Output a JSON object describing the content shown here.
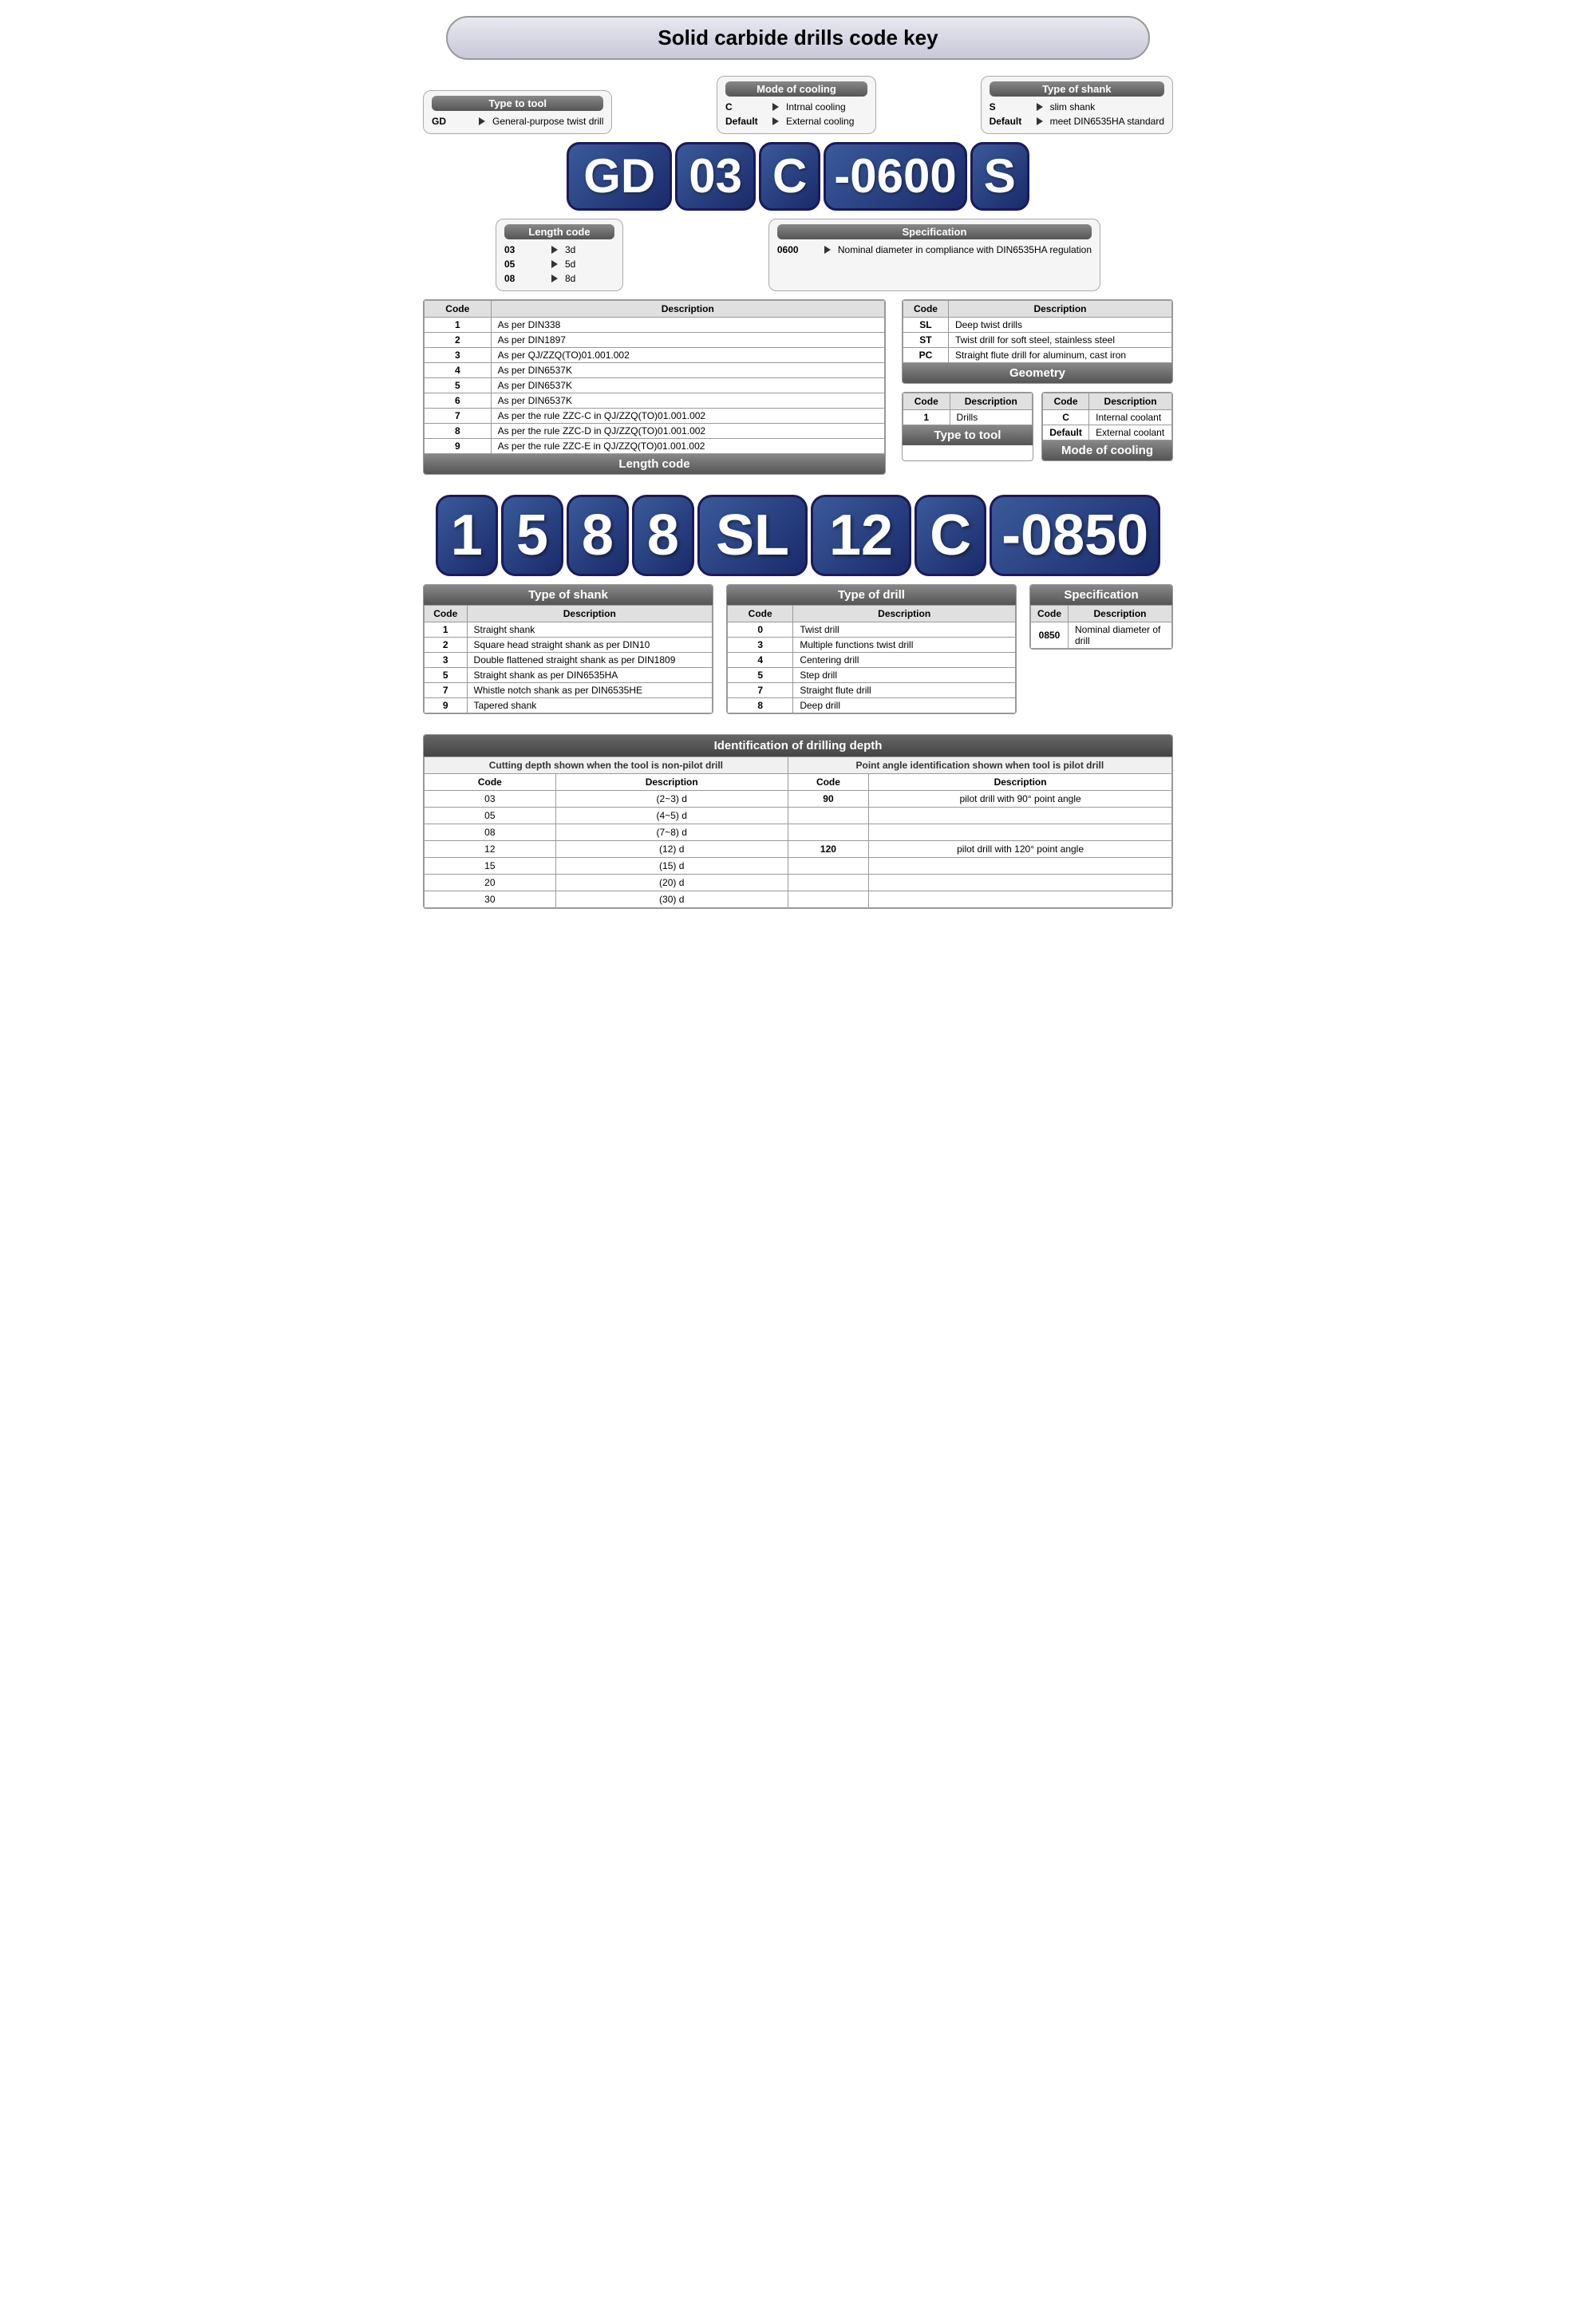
{
  "title": "Solid carbide drills code key",
  "section1": {
    "code_blocks": [
      "GD",
      "03",
      "C",
      "-0600",
      "S"
    ],
    "panels": {
      "type_to_tool": {
        "label": "Type to tool",
        "rows": [
          {
            "code": "GD",
            "desc": "General-purpose twist drill"
          }
        ]
      },
      "mode_of_cooling": {
        "label": "Mode of cooling",
        "rows": [
          {
            "code": "C",
            "desc": "Intrnal cooling"
          },
          {
            "code": "Default",
            "desc": "External cooling"
          }
        ]
      },
      "type_of_shank": {
        "label": "Type of shank",
        "rows": [
          {
            "code": "S",
            "desc": "slim shank"
          },
          {
            "code": "Default",
            "desc": "meet DIN6535HA standard"
          }
        ]
      },
      "length_code": {
        "label": "Length code",
        "rows": [
          {
            "code": "03",
            "desc": "3d"
          },
          {
            "code": "05",
            "desc": "5d"
          },
          {
            "code": "08",
            "desc": "8d"
          }
        ]
      },
      "specification": {
        "label": "Specification",
        "rows": [
          {
            "code": "0600",
            "desc": "Nominal diameter in compliance with DIN6535HA regulation"
          }
        ]
      }
    }
  },
  "section1_tables": {
    "main_table": {
      "headers": [
        "Code",
        "Description"
      ],
      "rows": [
        [
          "1",
          "As per DIN338"
        ],
        [
          "2",
          "As per DIN1897"
        ],
        [
          "3",
          "As per QJ/ZZQ(TO)01.001.002"
        ],
        [
          "4",
          "As per DIN6537K"
        ],
        [
          "5",
          "As per DIN6537K"
        ],
        [
          "6",
          "As per DIN6537K"
        ],
        [
          "7",
          "As per the rule ZZC-C in QJ/ZZQ(TO)01.001.002"
        ],
        [
          "8",
          "As per the rule ZZC-D in QJ/ZZQ(TO)01.001.002"
        ],
        [
          "9",
          "As per the rule ZZC-E in QJ/ZZQ(TO)01.001.002"
        ]
      ],
      "section_title": "Length code"
    },
    "geometry_table": {
      "headers": [
        "Code",
        "Description"
      ],
      "rows": [
        [
          "SL",
          "Deep twist drills"
        ],
        [
          "ST",
          "Twist drill for soft steel, stainless steel"
        ],
        [
          "PC",
          "Straight flute drill for aluminum, cast iron"
        ]
      ],
      "section_title": "Geometry"
    },
    "type_to_tool_table": {
      "headers": [
        "Code",
        "Description"
      ],
      "rows": [
        [
          "1",
          "Drills"
        ]
      ],
      "section_title": "Type to tool"
    },
    "mode_cooling_table": {
      "headers": [
        "Code",
        "Description"
      ],
      "rows": [
        [
          "C",
          "Internal coolant"
        ],
        [
          "Default",
          "External coolant"
        ]
      ],
      "section_title": "Mode of cooling"
    }
  },
  "section2": {
    "code_blocks": [
      "1",
      "5",
      "8",
      "8",
      "SL",
      "12",
      "C",
      "-0850"
    ],
    "tables": {
      "type_of_shank": {
        "section_title": "Type of shank",
        "headers": [
          "Code",
          "Description"
        ],
        "rows": [
          [
            "1",
            "Straight shank"
          ],
          [
            "2",
            "Square head straight shank as per DIN10"
          ],
          [
            "3",
            "Double flattened straight shank as per DIN1809"
          ],
          [
            "5",
            "Straight shank as per DIN6535HA"
          ],
          [
            "7",
            "Whistle notch shank as per DIN6535HE"
          ],
          [
            "9",
            "Tapered shank"
          ]
        ]
      },
      "type_of_drill": {
        "section_title": "Type of drill",
        "headers": [
          "Code",
          "Description"
        ],
        "rows": [
          [
            "0",
            "Twist drill"
          ],
          [
            "3",
            "Multiple functions twist drill"
          ],
          [
            "4",
            "Centering drill"
          ],
          [
            "5",
            "Step drill"
          ],
          [
            "7",
            "Straight flute drill"
          ],
          [
            "8",
            "Deep drill"
          ]
        ]
      },
      "specification": {
        "section_title": "Specification",
        "headers": [
          "Code",
          "Description"
        ],
        "rows": [
          [
            "0850",
            "Nominal diameter of drill"
          ]
        ]
      }
    }
  },
  "identification": {
    "title": "Identification of drilling depth",
    "left_header": "Cutting depth shown when the tool is non-pilot drill",
    "right_header": "Point angle identification shown when tool is pilot drill",
    "left_cols": [
      "Code",
      "Description"
    ],
    "right_cols": [
      "Code",
      "Description"
    ],
    "left_rows": [
      [
        "03",
        "(2~3) d"
      ],
      [
        "05",
        "(4~5) d"
      ],
      [
        "08",
        "(7~8) d"
      ],
      [
        "12",
        "(12) d"
      ],
      [
        "15",
        "(15) d"
      ],
      [
        "20",
        "(20) d"
      ],
      [
        "30",
        "(30) d"
      ]
    ],
    "right_rows": [
      {
        "code": "90",
        "desc": "pilot drill with 90° point angle"
      },
      {
        "code": "120",
        "desc": "pilot drill with 120° point angle"
      }
    ]
  }
}
